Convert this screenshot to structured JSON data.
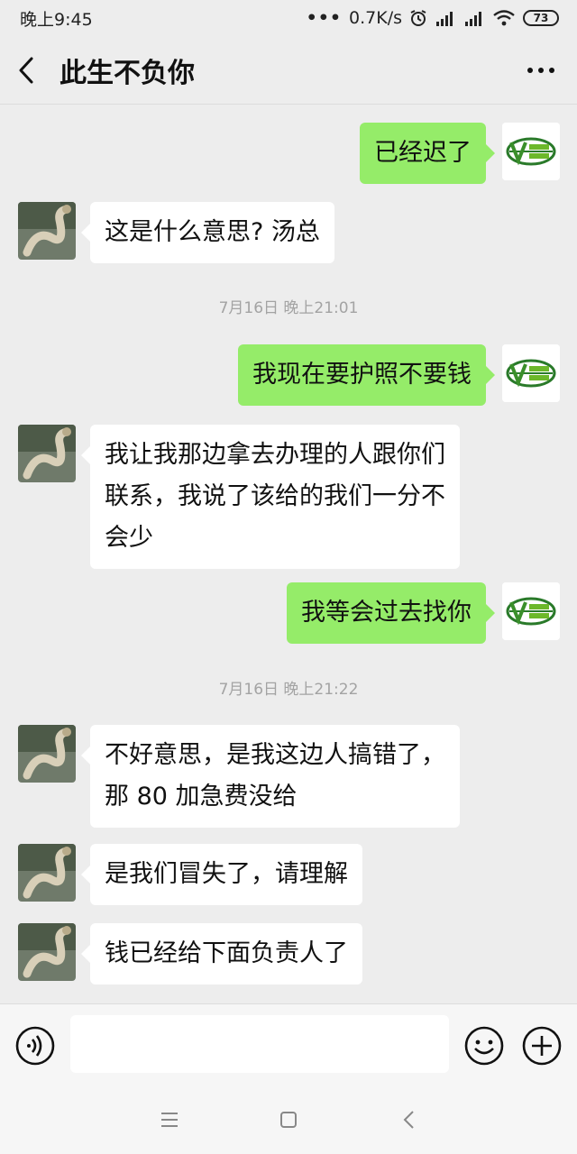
{
  "status_bar": {
    "time": "晚上9:45",
    "network_speed": "0.7K/s",
    "battery": "73"
  },
  "header": {
    "title": "此生不负你"
  },
  "messages": [
    {
      "side": "right",
      "text": "已经迟了"
    },
    {
      "side": "left",
      "text": "这是什么意思? 汤总"
    },
    {
      "side": "right",
      "text": "我现在要护照不要钱"
    },
    {
      "side": "left",
      "text_lines": [
        "我让我那边拿去办理的人跟你们",
        "联系，我说了该给的我们一分不",
        "会少"
      ]
    },
    {
      "side": "right",
      "text": "我等会过去找你"
    },
    {
      "side": "left",
      "text_lines": [
        "不好意思，是我这边人搞错了，",
        "那 80 加急费没给"
      ]
    },
    {
      "side": "left",
      "text": "是我们冒失了，请理解"
    },
    {
      "side": "left",
      "text": "钱已经给下面负责人了"
    }
  ],
  "timestamps": [
    "7月16日 晚上21:01",
    "7月16日 晚上21:22"
  ],
  "colors": {
    "self_bubble": "#95ec69",
    "other_bubble": "#ffffff",
    "background": "#ededed"
  },
  "input_bar": {
    "text_value": ""
  },
  "icons": {
    "back": "chevron-left-icon",
    "more": "more-dots-icon",
    "voice": "voice-icon",
    "emoji": "emoji-icon",
    "add": "plus-icon",
    "nav_menu": "menu-icon",
    "nav_home": "home-icon",
    "nav_back": "back-icon"
  }
}
